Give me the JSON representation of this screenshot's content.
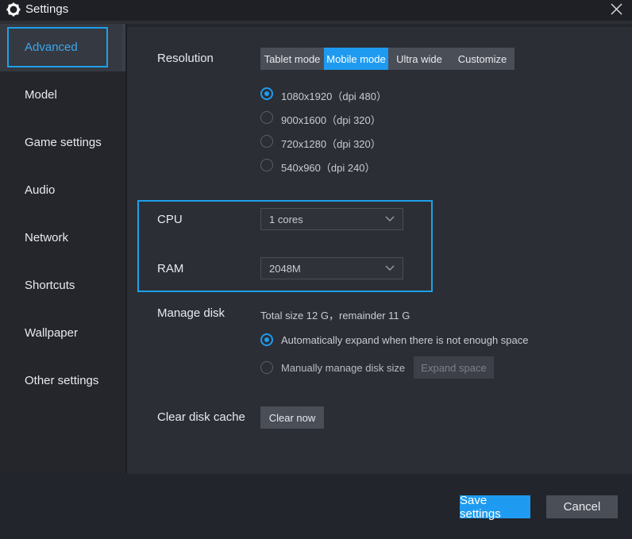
{
  "window": {
    "title": "Settings"
  },
  "sidebar": {
    "items": [
      {
        "label": "Advanced",
        "active": true
      },
      {
        "label": "Model"
      },
      {
        "label": "Game settings"
      },
      {
        "label": "Audio"
      },
      {
        "label": "Network"
      },
      {
        "label": "Shortcuts"
      },
      {
        "label": "Wallpaper"
      },
      {
        "label": "Other settings"
      }
    ]
  },
  "resolution": {
    "label": "Resolution",
    "modes": [
      "Tablet mode",
      "Mobile mode",
      "Ultra wide",
      "Customize"
    ],
    "selected_mode": "Mobile mode",
    "options": [
      {
        "text": "1080x1920（dpi 480）",
        "checked": true
      },
      {
        "text": "900x1600（dpi 320）"
      },
      {
        "text": "720x1280（dpi 320）"
      },
      {
        "text": "540x960（dpi 240）"
      }
    ]
  },
  "cpu": {
    "label": "CPU",
    "value": "1 cores"
  },
  "ram": {
    "label": "RAM",
    "value": "2048M"
  },
  "disk": {
    "label": "Manage disk",
    "summary": "Total size 12 G，remainder 11 G",
    "options": [
      {
        "text": "Automatically expand when there is not enough space",
        "checked": true
      },
      {
        "text": "Manually manage disk size"
      }
    ],
    "expand_button": "Expand space"
  },
  "cache": {
    "label": "Clear disk cache",
    "button": "Clear now"
  },
  "footer": {
    "save": "Save settings",
    "cancel": "Cancel"
  },
  "colors": {
    "accent": "#1e9bf0",
    "highlight": "#1ea0ea",
    "background": "#2b2e35"
  }
}
